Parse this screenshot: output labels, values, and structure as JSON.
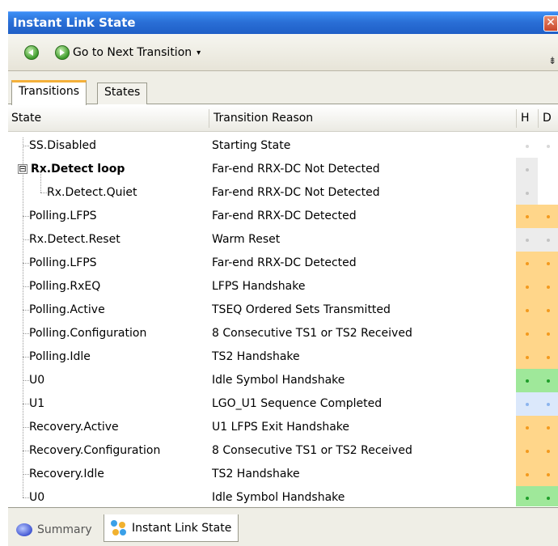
{
  "window": {
    "title": "Instant Link State",
    "close_glyph": "✕"
  },
  "toolbar": {
    "back_icon": "back-arrow-icon",
    "forward_icon": "forward-arrow-icon",
    "next_label": "Go to Next Transition",
    "dropdown_glyph": "▾",
    "overflow_glyph": "⇟"
  },
  "tabs": [
    {
      "label": "Transitions",
      "active": true
    },
    {
      "label": "States",
      "active": false
    }
  ],
  "columns": {
    "state": "State",
    "reason": "Transition Reason",
    "h": "H",
    "d": "D"
  },
  "colors": {
    "orange": "#ffd68a",
    "orange_dot": "#f39a1e",
    "green": "#9fe89a",
    "green_dot": "#1f9e2a",
    "blue": "#dbe8fb",
    "blue_dot": "#8cb4ee",
    "gray": "#ececec",
    "gray_dot": "#c4c4c4"
  },
  "rows": [
    {
      "state": "SS.Disabled",
      "reason": "Starting State",
      "level": 0,
      "h": "white",
      "d": "white",
      "bold": false
    },
    {
      "state": "Rx.Detect loop",
      "reason": "Far-end RRX-DC Not Detected",
      "level": 0,
      "h": "gray",
      "d": "none",
      "bold": true,
      "expander": "⊟"
    },
    {
      "state": "Rx.Detect.Quiet",
      "reason": "Far-end RRX-DC Not Detected",
      "level": 1,
      "h": "gray",
      "d": "none",
      "bold": false
    },
    {
      "state": "Polling.LFPS",
      "reason": "Far-end RRX-DC Detected",
      "level": 0,
      "h": "orange",
      "d": "orange",
      "bold": false
    },
    {
      "state": "Rx.Detect.Reset",
      "reason": "Warm Reset",
      "level": 0,
      "h": "gray",
      "d": "gray",
      "bold": false
    },
    {
      "state": "Polling.LFPS",
      "reason": "Far-end RRX-DC Detected",
      "level": 0,
      "h": "orange",
      "d": "orange",
      "bold": false
    },
    {
      "state": "Polling.RxEQ",
      "reason": "LFPS Handshake",
      "level": 0,
      "h": "orange",
      "d": "orange",
      "bold": false
    },
    {
      "state": "Polling.Active",
      "reason": "TSEQ Ordered Sets Transmitted",
      "level": 0,
      "h": "orange",
      "d": "orange",
      "bold": false
    },
    {
      "state": "Polling.Configuration",
      "reason": "8 Consecutive TS1 or TS2 Received",
      "level": 0,
      "h": "orange",
      "d": "orange",
      "bold": false
    },
    {
      "state": "Polling.Idle",
      "reason": "TS2 Handshake",
      "level": 0,
      "h": "orange",
      "d": "orange",
      "bold": false
    },
    {
      "state": "U0",
      "reason": "Idle Symbol Handshake",
      "level": 0,
      "h": "green",
      "d": "green",
      "bold": false
    },
    {
      "state": "U1",
      "reason": "LGO_U1 Sequence Completed",
      "level": 0,
      "h": "blue",
      "d": "blue",
      "bold": false
    },
    {
      "state": "Recovery.Active",
      "reason": "U1 LFPS Exit Handshake",
      "level": 0,
      "h": "orange",
      "d": "orange",
      "bold": false
    },
    {
      "state": "Recovery.Configuration",
      "reason": "8 Consecutive TS1 or TS2 Received",
      "level": 0,
      "h": "orange",
      "d": "orange",
      "bold": false
    },
    {
      "state": "Recovery.Idle",
      "reason": "TS2 Handshake",
      "level": 0,
      "h": "orange",
      "d": "orange",
      "bold": false
    },
    {
      "state": "U0",
      "reason": "Idle Symbol Handshake",
      "level": 0,
      "h": "green",
      "d": "green",
      "bold": false
    }
  ],
  "bottom_tabs": [
    {
      "label": "Summary",
      "icon": "summary-icon",
      "active": false
    },
    {
      "label": "Instant Link State",
      "icon": "instant-link-state-icon",
      "active": true
    }
  ]
}
